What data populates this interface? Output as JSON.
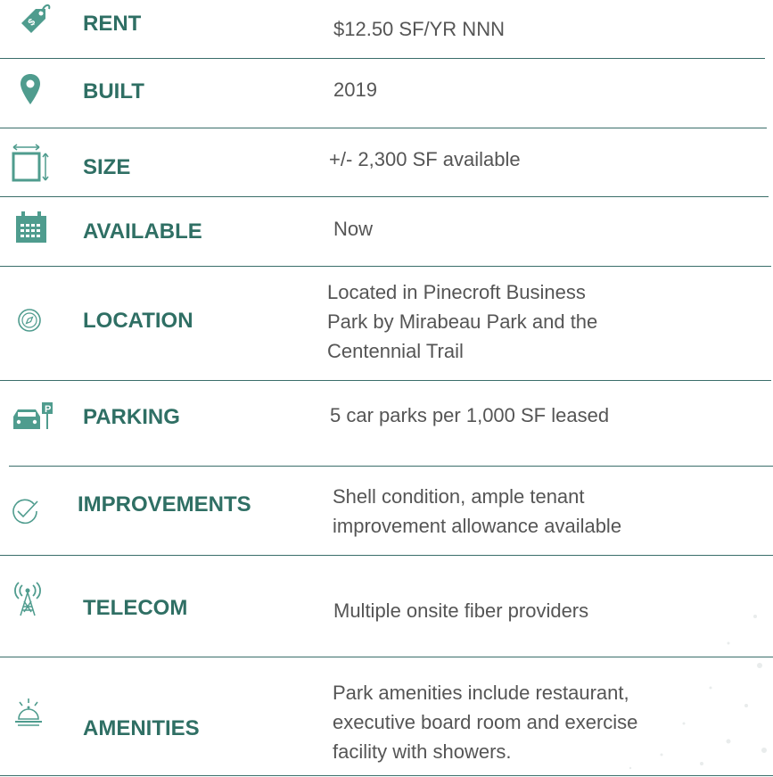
{
  "accent": "#2f6f64",
  "icon_color": "#4f9c8e",
  "rows": [
    {
      "icon": "price-tag-icon",
      "label": "RENT",
      "value": [
        "$12.50 SF/YR NNN"
      ]
    },
    {
      "icon": "location-pin-icon",
      "label": "BUILT",
      "value": [
        "2019"
      ]
    },
    {
      "icon": "dimensions-icon",
      "label": "SIZE",
      "value": [
        "+/- 2,300 SF available"
      ]
    },
    {
      "icon": "calendar-icon",
      "label": "AVAILABLE",
      "value": [
        "Now"
      ]
    },
    {
      "icon": "compass-icon",
      "label": "LOCATION",
      "value": [
        "Located in Pinecroft Business",
        "Park by Mirabeau Park and the",
        "Centennial Trail"
      ]
    },
    {
      "icon": "parking-icon",
      "label": "PARKING",
      "value": [
        "5 car parks per 1,000 SF leased"
      ]
    },
    {
      "icon": "checkmark-icon",
      "label": "IMPROVEMENTS",
      "value": [
        "Shell condition, ample tenant",
        "improvement allowance available"
      ]
    },
    {
      "icon": "antenna-tower-icon",
      "label": "TELECOM",
      "value": [
        "Multiple onsite fiber providers"
      ]
    },
    {
      "icon": "service-bell-icon",
      "label": "AMENITIES",
      "value": [
        "Park amenities include restaurant,",
        "executive board room and exercise",
        "facility with showers."
      ]
    }
  ]
}
